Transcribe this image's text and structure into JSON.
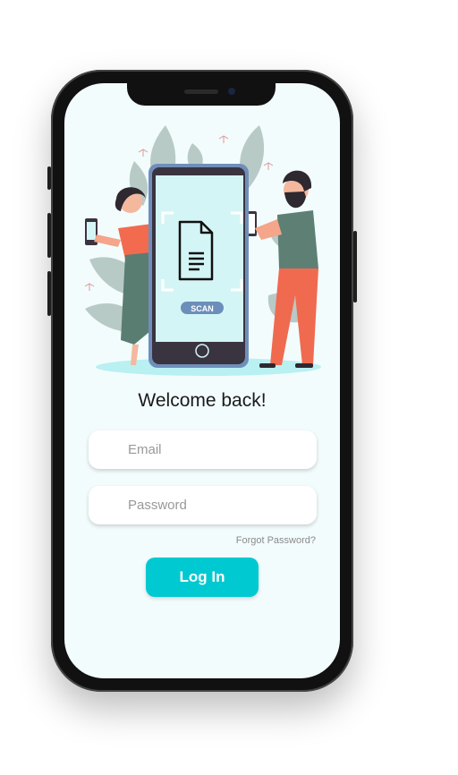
{
  "illustration": {
    "scan_label": "SCAN"
  },
  "login": {
    "title": "Welcome back!",
    "email_placeholder": "Email",
    "password_placeholder": "Password",
    "forgot_password": "Forgot Password?",
    "login_button": "Log In"
  },
  "colors": {
    "accent": "#00c9d1",
    "background": "#f3fcfd"
  }
}
